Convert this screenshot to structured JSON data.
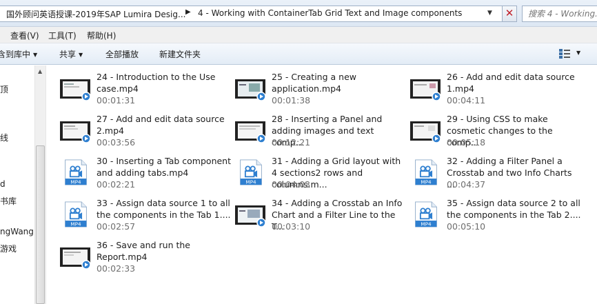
{
  "address": {
    "crumbs": [
      "国外顾问英语授课-2019年SAP Lumira Desig...",
      "4 - Working with ContainerTab Grid Text and Image components"
    ],
    "search_placeholder": "搜索 4 - Working..."
  },
  "menu": [
    "查看(V)",
    "工具(T)",
    "帮助(H)"
  ],
  "toolbar": {
    "include_in_library": "含到库中",
    "share": "共享",
    "play_all": "全部播放",
    "new_folder": "新建文件夹"
  },
  "nav_items": [
    "顶",
    "线",
    "d",
    "书库",
    "ngWang",
    "游戏"
  ],
  "files": [
    {
      "name": "24 - Introduction to the Use case.mp4",
      "duration": "00:01:31",
      "thumb": "video-frame"
    },
    {
      "name": "25 - Creating a new application.mp4",
      "duration": "00:01:38",
      "thumb": "video-frame-app"
    },
    {
      "name": "26 - Add and edit data source 1.mp4",
      "duration": "00:04:11",
      "thumb": "video-frame"
    },
    {
      "name": "27 - Add and edit data source 2.mp4",
      "duration": "00:03:56",
      "thumb": "video-frame"
    },
    {
      "name": "28 - Inserting a Panel and adding images and text comp...",
      "duration": "00:12:21",
      "thumb": "video-frame"
    },
    {
      "name": "29 - Using CSS to make cosmetic changes to the comp...",
      "duration": "00:05:18",
      "thumb": "video-frame"
    },
    {
      "name": "30 - Inserting a Tab component and adding tabs.mp4",
      "duration": "00:02:21",
      "thumb": "mp4-icon"
    },
    {
      "name": "31 - Adding a Grid layout with 4 sections2 rows and columns.m...",
      "duration": "00:04:03",
      "thumb": "mp4-icon"
    },
    {
      "name": "32 - Adding a Filter Panel a Crosstab and two Info Charts ...",
      "duration": "00:04:37",
      "thumb": "mp4-icon"
    },
    {
      "name": "33 - Assign data source 1 to all the components in the Tab 1....",
      "duration": "00:02:57",
      "thumb": "mp4-icon"
    },
    {
      "name": "34 - Adding a Crosstab an Info Chart and a Filter Line to the T...",
      "duration": "00:03:10",
      "thumb": "video-frame-app"
    },
    {
      "name": "35 - Assign data source 2 to all the components in the Tab 2....",
      "duration": "00:05:10",
      "thumb": "mp4-icon"
    },
    {
      "name": "36 - Save and run the Report.mp4",
      "duration": "00:02:33",
      "thumb": "video-frame"
    }
  ],
  "mp4_badge": "MP4",
  "colors": {
    "duration": "#6d6d6d",
    "close": "#c0202a",
    "mp4_blue": "#2e7fd0"
  }
}
